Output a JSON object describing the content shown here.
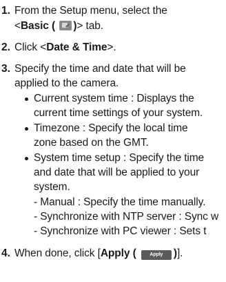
{
  "steps": {
    "s1": {
      "number": "1.",
      "line1": "From the Setup menu, select the",
      "line2_pre": "<",
      "line2_bold": "Basic (",
      "line2_bold_close": ")",
      "line2_post": "> tab.",
      "icon": "basic-settings-icon"
    },
    "s2": {
      "number": "2.",
      "pre": "Click <",
      "bold": "Date & Time",
      "post": ">."
    },
    "s3": {
      "number": "3.",
      "line1": "Specify the time and date that will be",
      "line2": "applied to the camera.",
      "bullets": [
        {
          "line1": "Current system time : Displays the",
          "line2": "current time settings of your system."
        },
        {
          "line1": "Timezone : Specify the local time",
          "line2": "zone based on the GMT."
        },
        {
          "line1": "System time setup : Specify the time",
          "line2": "and date that will be applied to your",
          "line3": "system."
        }
      ],
      "sub": [
        "- Manual : Specify the time manually.",
        "- Synchronize with NTP server : Sync w",
        "- Synchronize with PC viewer : Sets t"
      ]
    },
    "s4": {
      "number": "4.",
      "pre": "When done, click [",
      "bold": "Apply (",
      "button_label": "Apply",
      "bold_close": ")",
      "post": "]."
    }
  }
}
